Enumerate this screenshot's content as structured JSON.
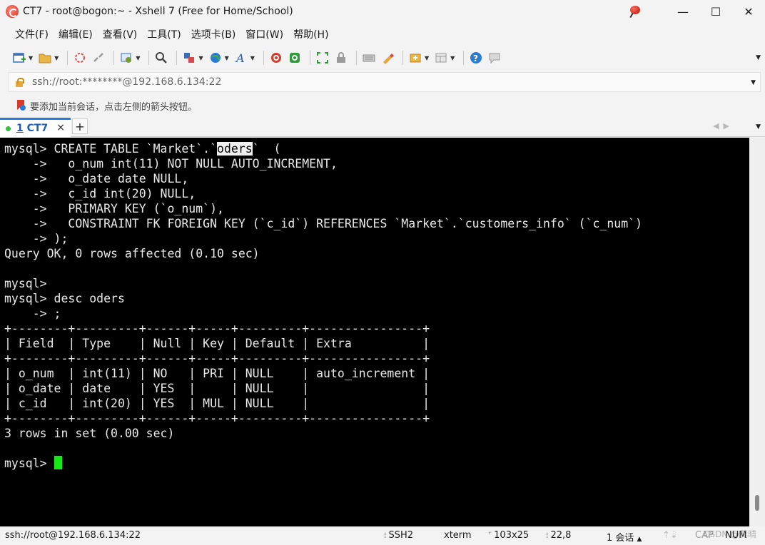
{
  "window": {
    "title": "CT7 - root@bogon:~ - Xshell 7 (Free for Home/School)",
    "minimize": "—",
    "maximize": "☐",
    "close": "✕"
  },
  "menu": [
    "文件(F)",
    "编辑(E)",
    "查看(V)",
    "工具(T)",
    "选项卡(B)",
    "窗口(W)",
    "帮助(H)"
  ],
  "address": {
    "value": "ssh://root:********@192.168.6.134:22"
  },
  "hint": "要添加当前会话，点击左侧的箭头按钮。",
  "tab": {
    "number": "1",
    "label": "CT7",
    "close": "×",
    "add": "+"
  },
  "terminal": {
    "lines": [
      {
        "pre": "mysql> CREATE TABLE `Market`.`",
        "hl": "oders",
        "post": "`  ("
      },
      {
        "text": "    ->   o_num int(11) NOT NULL AUTO_INCREMENT,"
      },
      {
        "text": "    ->   o_date date NULL,"
      },
      {
        "text": "    ->   c_id int(20) NULL,"
      },
      {
        "text": "    ->   PRIMARY KEY (`o_num`),"
      },
      {
        "text": "    ->   CONSTRAINT FK FOREIGN KEY (`c_id`) REFERENCES `Market`.`customers_info` (`c_num`)"
      },
      {
        "text": "    -> );"
      },
      {
        "text": "Query OK, 0 rows affected (0.10 sec)"
      },
      {
        "text": ""
      },
      {
        "text": "mysql>"
      },
      {
        "text": "mysql> desc oders"
      },
      {
        "text": "    -> ;"
      },
      {
        "text": "+--------+---------+------+-----+---------+----------------+"
      },
      {
        "text": "| Field  | Type    | Null | Key | Default | Extra          |"
      },
      {
        "text": "+--------+---------+------+-----+---------+----------------+"
      },
      {
        "text": "| o_num  | int(11) | NO   | PRI | NULL    | auto_increment |"
      },
      {
        "text": "| o_date | date    | YES  |     | NULL    |                |"
      },
      {
        "text": "| c_id   | int(20) | YES  | MUL | NULL    |                |"
      },
      {
        "text": "+--------+---------+------+-----+---------+----------------+"
      },
      {
        "text": "3 rows in set (0.00 sec)"
      },
      {
        "text": ""
      }
    ],
    "prompt": "mysql> "
  },
  "status": {
    "connection": "ssh://root@192.168.6.134:22",
    "protocol": "SSH2",
    "term": "xterm",
    "size": "103x25",
    "cursor_pos": "22,8",
    "sessions": "1 会话",
    "cap": "CAP",
    "num": "NUM",
    "watermark": "CSDN @莫晴"
  }
}
